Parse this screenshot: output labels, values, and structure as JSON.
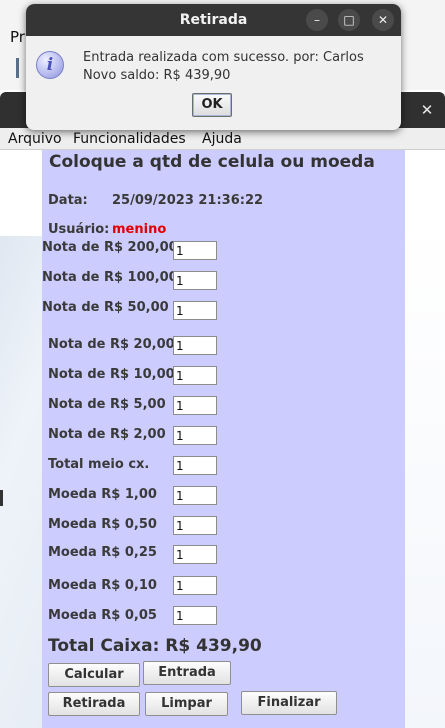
{
  "background_app": {
    "menu_fragment": "Pr",
    "menu": [
      "Arquivo",
      "Funcionalidades",
      "Ajuda"
    ],
    "close_glyph": "✕"
  },
  "panel": {
    "title": "Coloque a qtd de celula ou moeda",
    "date_label": "Data:",
    "date_value": "25/09/2023 21:36:22",
    "user_label": "Usuário:",
    "user_value": "menino",
    "user_color": "#e00000",
    "denominations": [
      {
        "label": "Nota de R$ 200,00",
        "value": "1"
      },
      {
        "label": "Nota de R$ 100,00",
        "value": "1"
      },
      {
        "label": "Nota de R$ 50,00",
        "value": "1"
      },
      {
        "label": "Nota de R$ 20,00",
        "value": "1"
      },
      {
        "label": "Nota de R$ 10,00",
        "value": "1"
      },
      {
        "label": "Nota de R$ 5,00",
        "value": "1"
      },
      {
        "label": "Nota de R$ 2,00",
        "value": "1"
      },
      {
        "label": "Total meio cx.",
        "value": "1"
      },
      {
        "label": "Moeda R$ 1,00",
        "value": "1"
      },
      {
        "label": "Moeda R$ 0,50",
        "value": "1"
      },
      {
        "label": "Moeda R$ 0,25",
        "value": "1"
      },
      {
        "label": "Moeda R$ 0,10",
        "value": "1"
      },
      {
        "label": "Moeda R$ 0,05",
        "value": "1"
      }
    ],
    "total_label": "Total Caixa:",
    "total_value": "R$ 439,90",
    "buttons": {
      "calcular": "Calcular",
      "entrada": "Entrada",
      "retirada": "Retirada",
      "limpar": "Limpar",
      "finalizar": "Finalizar"
    },
    "background_color": "#ccccff"
  },
  "dialog": {
    "title": "Retirada",
    "message_line1": "Entrada realizada com sucesso. por: Carlos",
    "message_line2": "Novo saldo: R$ 439,90",
    "ok_label": "OK",
    "info_glyph": "i",
    "minimize_glyph": "–",
    "maximize_glyph": "□",
    "close_glyph": "✕"
  }
}
